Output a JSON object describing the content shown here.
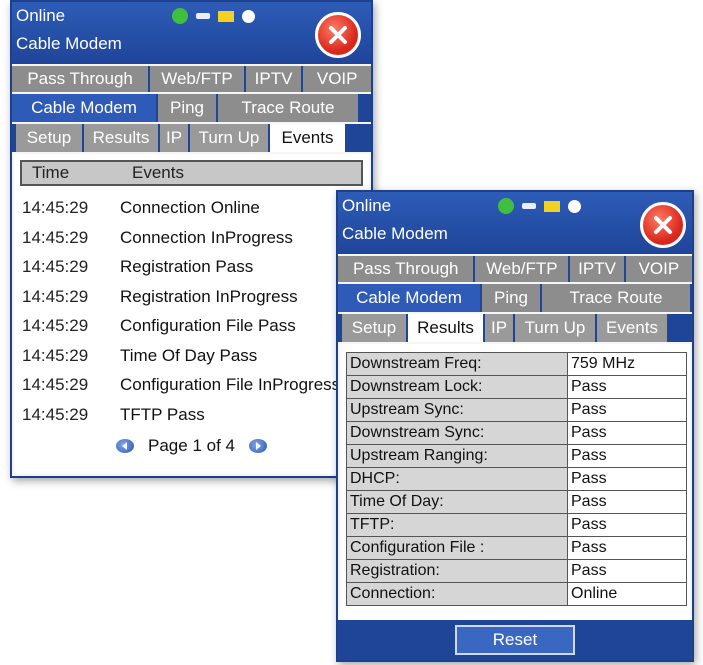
{
  "events_window": {
    "status": "Online",
    "device": "Cable Modem",
    "tabs_row1": [
      "Pass Through",
      "Web/FTP",
      "IPTV",
      "VOIP"
    ],
    "tabs_row2": [
      "Cable Modem",
      "Ping",
      "Trace Route"
    ],
    "subtabs": [
      "Setup",
      "Results",
      "IP",
      "Turn Up",
      "Events"
    ],
    "active_subtab": "Events",
    "columns": {
      "time": "Time",
      "events": "Events"
    },
    "rows": [
      {
        "time": "14:45:29",
        "event": "Connection Online"
      },
      {
        "time": "14:45:29",
        "event": "Connection InProgress"
      },
      {
        "time": "14:45:29",
        "event": "Registration Pass"
      },
      {
        "time": "14:45:29",
        "event": "Registration InProgress"
      },
      {
        "time": "14:45:29",
        "event": "Configuration File Pass"
      },
      {
        "time": "14:45:29",
        "event": "Time Of Day Pass"
      },
      {
        "time": "14:45:29",
        "event": "Configuration File InProgress"
      },
      {
        "time": "14:45:29",
        "event": "TFTP Pass"
      }
    ],
    "pager": "Page 1 of 4"
  },
  "results_window": {
    "status": "Online",
    "device": "Cable Modem",
    "tabs_row1": [
      "Pass Through",
      "Web/FTP",
      "IPTV",
      "VOIP"
    ],
    "tabs_row2": [
      "Cable Modem",
      "Ping",
      "Trace Route"
    ],
    "subtabs": [
      "Setup",
      "Results",
      "IP",
      "Turn Up",
      "Events"
    ],
    "active_subtab": "Results",
    "results": [
      {
        "label": "Downstream Freq:",
        "value": "759 MHz"
      },
      {
        "label": "Downstream Lock:",
        "value": "Pass"
      },
      {
        "label": "Upstream Sync:",
        "value": "Pass"
      },
      {
        "label": "Downstream Sync:",
        "value": "Pass"
      },
      {
        "label": "Upstream Ranging:",
        "value": "Pass"
      },
      {
        "label": "DHCP:",
        "value": "Pass"
      },
      {
        "label": "Time Of Day:",
        "value": "Pass"
      },
      {
        "label": "TFTP:",
        "value": "Pass"
      },
      {
        "label": "Configuration File :",
        "value": "Pass"
      },
      {
        "label": "Registration:",
        "value": "Pass"
      },
      {
        "label": "Connection:",
        "value": "Online"
      }
    ],
    "reset_label": "Reset"
  },
  "icons": {
    "ip": "ip-status-icon",
    "plug": "power-plug-icon",
    "battery": "battery-icon",
    "bluetooth": "bluetooth-icon",
    "close": "close-icon"
  },
  "colors": {
    "titlebar": "#1f4599",
    "tab_inactive": "#8d8d8d",
    "close_red": "#d9261c"
  }
}
